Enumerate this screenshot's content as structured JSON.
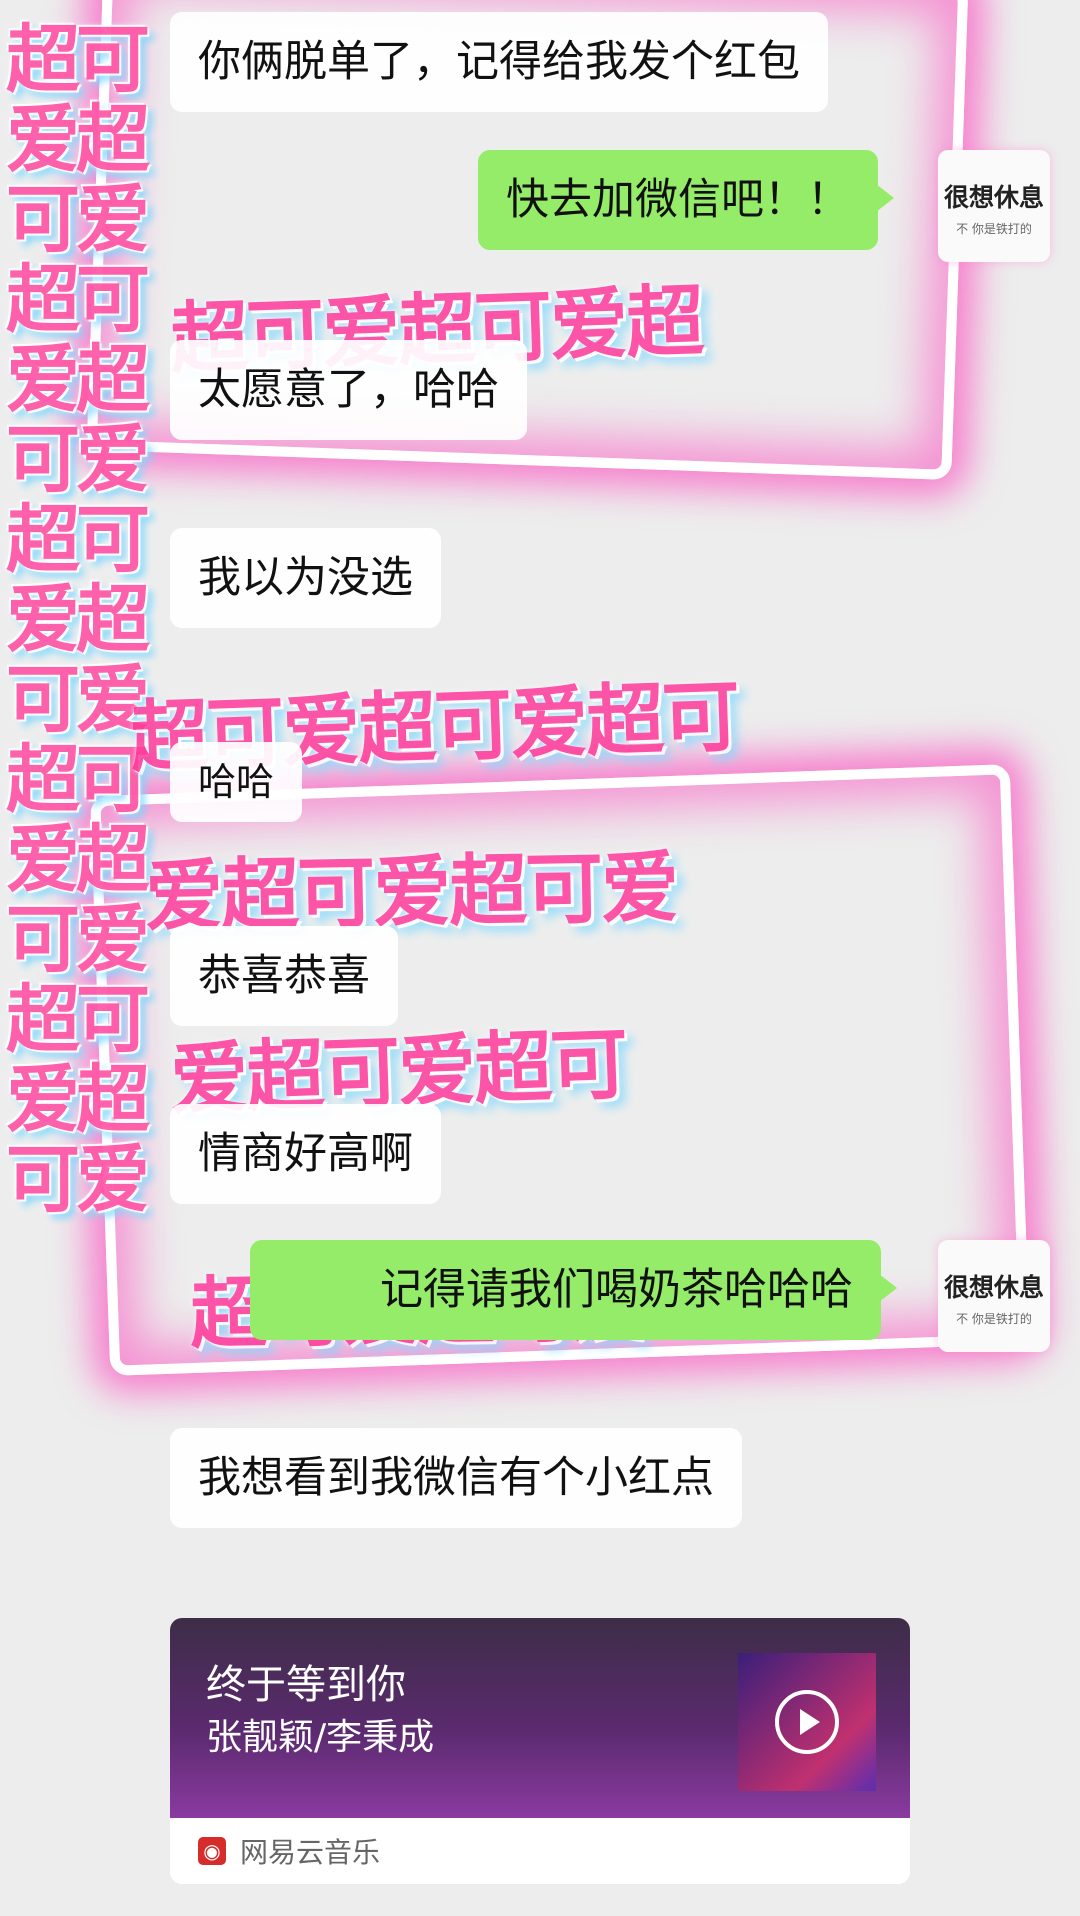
{
  "messages": [
    {
      "side": "in",
      "text": "你俩脱单了，记得给我发个红包"
    },
    {
      "side": "out",
      "text": "快去加微信吧！！"
    },
    {
      "side": "in",
      "text": "太愿意了，哈哈"
    },
    {
      "side": "in",
      "text": "我以为没选"
    },
    {
      "side": "in",
      "text": "哈哈"
    },
    {
      "side": "in",
      "text": "恭喜恭喜"
    },
    {
      "side": "in",
      "text": "情商好高啊"
    },
    {
      "side": "out",
      "text": "记得请我们喝奶茶哈哈哈"
    },
    {
      "side": "in",
      "text": "我想看到我微信有个小红点"
    }
  ],
  "avatar": {
    "line1": "很想休息",
    "line2": "不 你是铁打的"
  },
  "sticker_text": {
    "side": "超可爱超可爱超可爱超可爱超可爱超可爱超可爱超可爱超可爱超可爱",
    "diag1": "超可爱超可爱超",
    "diag2": "超可爱超可爱超可",
    "diag3": "爱超可爱超可爱",
    "diag4": "爱超可爱超可",
    "diag5": "超可爱超可爱"
  },
  "music_card": {
    "title": "终于等到你",
    "artist": "张靓颖/李秉成",
    "source": "网易云音乐"
  },
  "colors": {
    "out_bubble": "#95ec69",
    "sticker_pink": "#ff3a9a",
    "frame_glow": "#ff28b4"
  }
}
